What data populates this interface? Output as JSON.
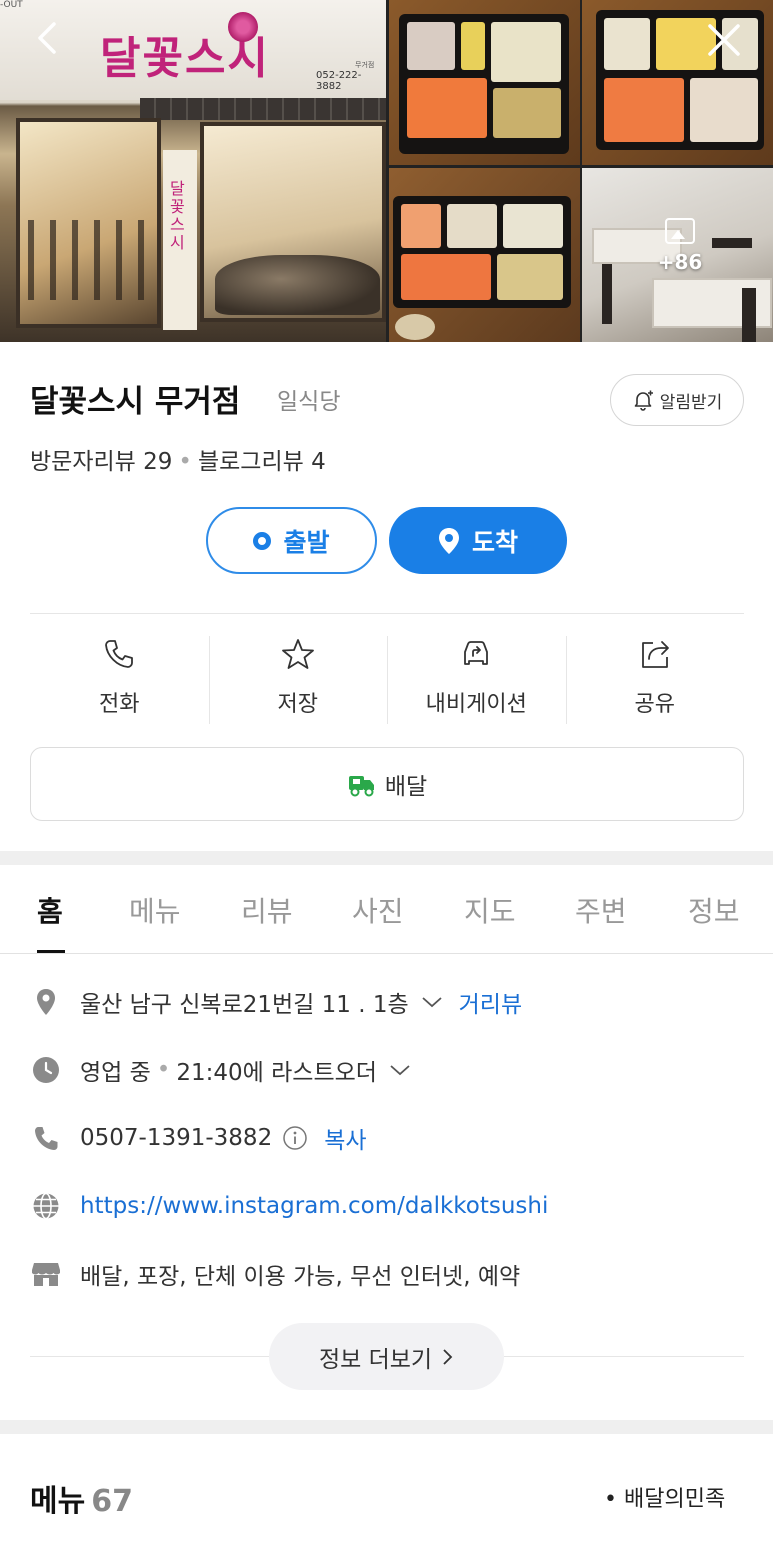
{
  "gallery": {
    "sign_name": "달꽃스시",
    "sign_phone": "052-222-3882",
    "sign_branch": "무거점",
    "door_text": "달꽃스시",
    "window_text": "달꽃스시",
    "corner_text": "-OUT",
    "more_count": "+86"
  },
  "place": {
    "name": "달꽃스시 무거점",
    "category": "일식당",
    "alert_label": "알림받기",
    "visitor_reviews": "방문자리뷰 29",
    "blog_reviews": "블로그리뷰 4"
  },
  "route": {
    "depart_label": "출발",
    "arrive_label": "도착"
  },
  "actions": [
    {
      "label": "전화",
      "icon": "phone-icon"
    },
    {
      "label": "저장",
      "icon": "star-icon"
    },
    {
      "label": "내비게이션",
      "icon": "car-navigation-icon"
    },
    {
      "label": "공유",
      "icon": "share-icon"
    }
  ],
  "delivery": {
    "label": "배달",
    "icon": "delivery-truck-icon"
  },
  "tabs": [
    "홈",
    "메뉴",
    "리뷰",
    "사진",
    "지도",
    "주변",
    "정보"
  ],
  "info": {
    "address": "울산 남구 신복로21번길 11 . 1층",
    "street_view": "거리뷰",
    "status": "영업 중",
    "last_order": "21:40에 라스트오더",
    "phone": "0507-1391-3882",
    "copy_label": "복사",
    "website": "https://www.instagram.com/dalkkotsushi",
    "amenities": "배달, 포장, 단체 이용 가능, 무선 인터넷, 예약",
    "more_label": "정보 더보기"
  },
  "menu": {
    "title": "메뉴",
    "count": "67",
    "source": "배달의민족"
  },
  "colors": {
    "accent_blue": "#1a7fe6",
    "link_blue": "#1a6fd4",
    "delivery_green": "#2aa84a",
    "sign_pink": "#c0237a"
  }
}
